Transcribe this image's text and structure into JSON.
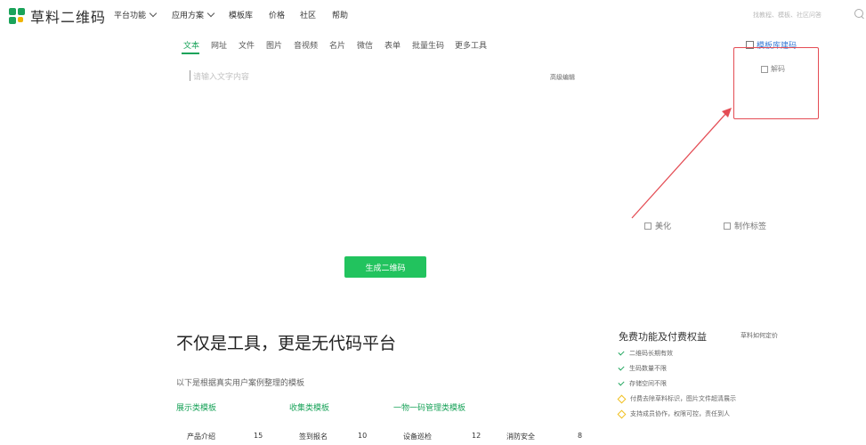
{
  "brand": {
    "name": "草料二维码",
    "accent": "#1aa35a",
    "button_green": "#22c35e",
    "highlight_red": "#e44c54"
  },
  "nav": {
    "items": [
      {
        "label": "平台功能",
        "dropdown": true
      },
      {
        "label": "应用方案",
        "dropdown": true
      },
      {
        "label": "模板库",
        "dropdown": false
      },
      {
        "label": "价格",
        "dropdown": false
      },
      {
        "label": "社区",
        "dropdown": false
      },
      {
        "label": "帮助",
        "dropdown": false
      }
    ],
    "search_placeholder": "找教程、模板、社区问答"
  },
  "tabs": [
    "文本",
    "网址",
    "文件",
    "图片",
    "音视频",
    "名片",
    "微信",
    "表单",
    "批量生码",
    "更多工具"
  ],
  "template_link": "模板库建码",
  "editor": {
    "placeholder": "请输入文字内容",
    "advanced": "高级编辑"
  },
  "side_options": {
    "decode": "解码",
    "beautify": "美化",
    "label": "制作标签"
  },
  "generate_button": "生成二维码",
  "section": {
    "headline": "不仅是工具，更是无代码平台",
    "subtitle": "以下是根据真实用户案例整理的模板",
    "categories": [
      "展示类模板",
      "收集类模板",
      "一物一码管理类模板"
    ],
    "templates": [
      {
        "name": "产品介绍",
        "count": "15"
      },
      {
        "name": "签到报名",
        "count": "10"
      },
      {
        "name": "设备巡检",
        "count": "12"
      },
      {
        "name": "消防安全",
        "count": "8"
      }
    ]
  },
  "features": {
    "title": "免费功能及付费权益",
    "link": "草料如何定价",
    "free": [
      "二维码长期有效",
      "生码数量不限",
      "存储空间不限"
    ],
    "paid": [
      "付费去除草料标识，图片文件超清展示",
      "支持成员协作，权限可控，责任到人"
    ]
  }
}
